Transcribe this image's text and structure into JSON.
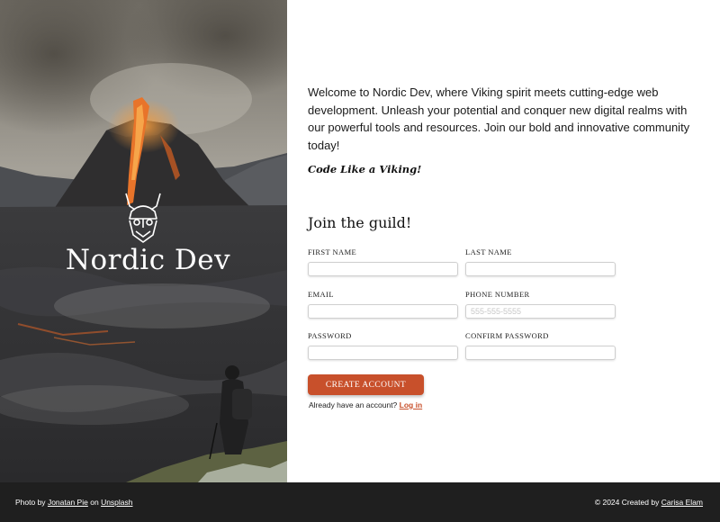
{
  "brand": {
    "name": "Nordic Dev"
  },
  "intro": {
    "text": "Welcome to Nordic Dev, where Viking spirit meets cutting-edge web development. Unleash your potential and conquer new digital realms with our powerful tools and resources. Join our bold and innovative community today!",
    "tagline": "Code Like a Viking!"
  },
  "form": {
    "title": "Join the guild!",
    "fields": {
      "first_name": {
        "label": "FIRST NAME",
        "placeholder": ""
      },
      "last_name": {
        "label": "LAST NAME",
        "placeholder": ""
      },
      "email": {
        "label": "EMAIL",
        "placeholder": ""
      },
      "phone": {
        "label": "PHONE NUMBER",
        "placeholder": "555-555-5555"
      },
      "password": {
        "label": "PASSWORD",
        "placeholder": ""
      },
      "confirm_password": {
        "label": "CONFIRM PASSWORD",
        "placeholder": ""
      }
    },
    "submit_label": "CREATE ACCOUNT",
    "login_prompt": "Already have an account?",
    "login_link": "Log in"
  },
  "footer": {
    "photo_prefix": "Photo by",
    "photographer": "Jonatan Pie",
    "photo_on": "on",
    "photo_source": "Unsplash",
    "copyright_prefix": "© 2024 Created by",
    "creator": "Carisa Elam"
  },
  "colors": {
    "accent": "#c8502b",
    "footer_bg": "#1f1f1f",
    "lava": "#e8742a"
  },
  "icons": {
    "logo": "viking-helmet-icon"
  }
}
